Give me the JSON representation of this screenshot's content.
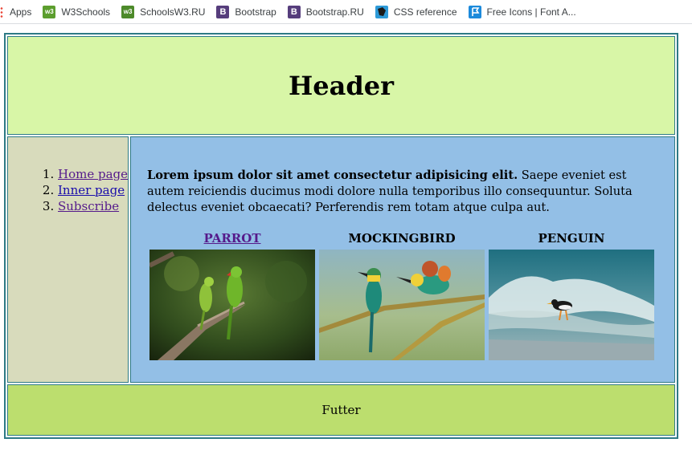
{
  "bookmarks": [
    {
      "label": "Apps",
      "icon": "apps-icon"
    },
    {
      "label": "W3Schools",
      "icon": "w3schools-icon"
    },
    {
      "label": "SchoolsW3.RU",
      "icon": "schoolsw3-icon"
    },
    {
      "label": "Bootstrap",
      "icon": "bootstrap-icon"
    },
    {
      "label": "Bootstrap.RU",
      "icon": "bootstrap-icon"
    },
    {
      "label": "CSS reference",
      "icon": "css-reference-icon"
    },
    {
      "label": "Free Icons | Font A...",
      "icon": "font-awesome-icon"
    }
  ],
  "header": {
    "title": "Header"
  },
  "sidebar": {
    "items": [
      {
        "label": "Home page"
      },
      {
        "label": "Inner page"
      },
      {
        "label": "Subscribe"
      }
    ]
  },
  "content": {
    "lead_bold": "Lorem ipsum dolor sit amet consectetur adipisicing elit.",
    "lead_text": " Saepe eveniet est autem reiciendis ducimus modi dolore nulla temporibus illo consequuntur. Soluta delectus eveniet obcaecati? Perferendis rem totam atque culpa aut.",
    "gallery": [
      {
        "caption": "PARROT",
        "image": "parrot-image"
      },
      {
        "caption": "MOCKINGBIRD",
        "image": "mockingbird-image"
      },
      {
        "caption": "PENGUIN",
        "image": "penguin-image"
      }
    ]
  },
  "footer": {
    "text": "Futter"
  },
  "colors": {
    "header_bg": "#d8f6a7",
    "sidebar_bg": "#d8dbbc",
    "content_bg": "#93bfe6",
    "footer_bg": "#bcde6e",
    "border": "#2e7a85"
  }
}
